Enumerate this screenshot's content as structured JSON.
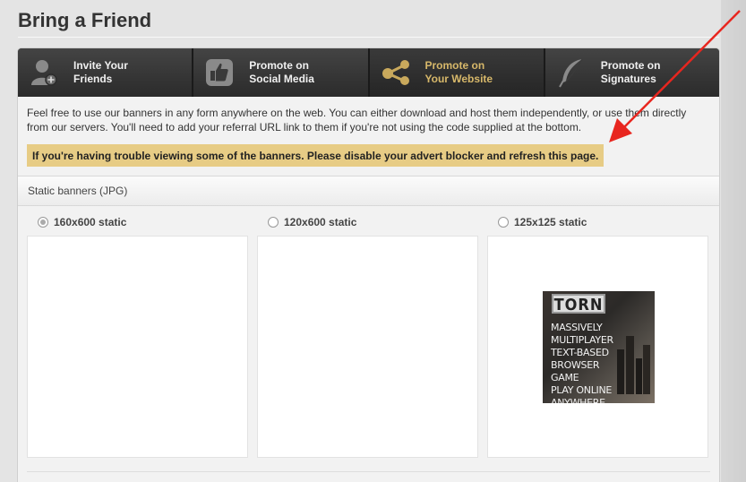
{
  "page": {
    "title": "Bring a Friend"
  },
  "tabs": [
    {
      "label": "Invite Your\nFriends",
      "icon": "user-add-icon",
      "active": false
    },
    {
      "label": "Promote on\nSocial Media",
      "icon": "thumbs-up-icon",
      "active": false
    },
    {
      "label": "Promote on\nYour Website",
      "icon": "share-icon",
      "active": true
    },
    {
      "label": "Promote on\nSignatures",
      "icon": "feather-icon",
      "active": false
    }
  ],
  "intro": "Feel free to use our banners in any form anywhere on the web. You can either download and host them independently, or use them directly from our servers. You'll need to add your referral URL link to them if you're not using the code supplied at the bottom.",
  "notice": "If you're having trouble viewing some of the banners. Please disable your advert blocker and refresh this page.",
  "section": {
    "title": "Static banners (JPG)"
  },
  "banners": [
    {
      "label": "160x600 static",
      "selected": true
    },
    {
      "label": "120x600 static",
      "selected": false
    },
    {
      "label": "125x125 static",
      "selected": false
    }
  ],
  "torn_banner": {
    "logo": "TORN",
    "text": "MASSIVELY\nMULTIPLAYER\nTEXT-BASED\nBROWSER GAME\nPLAY ONLINE\nANYWHERE"
  },
  "colors": {
    "accent": "#d7b86a",
    "notice_bg": "#e7cc85",
    "arrow": "#e8261f"
  }
}
